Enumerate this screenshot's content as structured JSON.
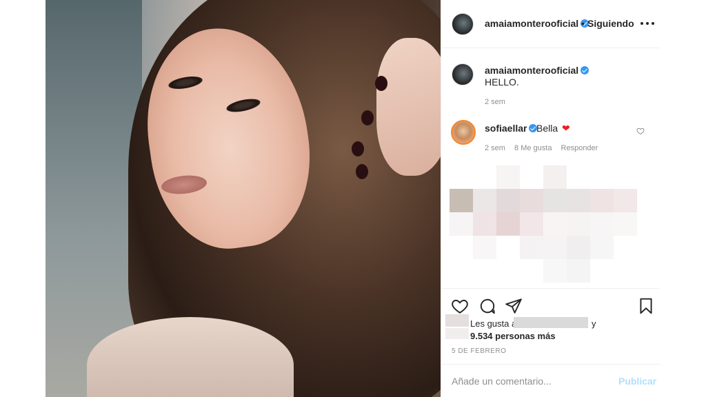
{
  "post": {
    "photo_alt": "photo-of-woman"
  },
  "header": {
    "username": "amaiamonterooficial",
    "separator": "•",
    "follow_status": "Siguiendo",
    "more_icon": "more-horizontal-icon"
  },
  "caption": {
    "username": "amaiamonterooficial",
    "text": "HELLO.",
    "time": "2 sem"
  },
  "comment": {
    "username": "sofiaellar",
    "text": "Bella",
    "heart": "❤",
    "time": "2 sem",
    "likes": "8 Me gusta",
    "reply": "Responder"
  },
  "likes": {
    "prefix": "Les gusta a",
    "and": "y",
    "others": "9.534 personas más"
  },
  "date": "5 DE FEBRERO",
  "compose": {
    "placeholder": "Añade un comentario...",
    "post_label": "Publicar"
  },
  "colors": {
    "verified": "#3897f0",
    "heart": "#ed1c24",
    "post_disabled": "#b2dffc"
  }
}
